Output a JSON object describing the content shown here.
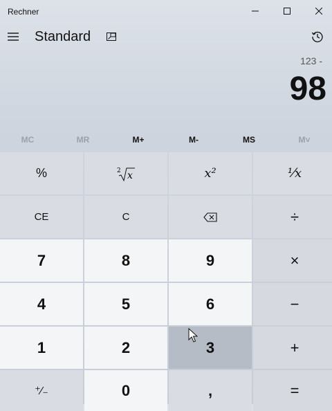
{
  "window": {
    "title": "Rechner"
  },
  "header": {
    "mode": "Standard"
  },
  "display": {
    "expression": "123 -",
    "value": "98"
  },
  "memory": [
    {
      "label": "MC",
      "enabled": false
    },
    {
      "label": "MR",
      "enabled": false
    },
    {
      "label": "M+",
      "enabled": true
    },
    {
      "label": "M-",
      "enabled": true
    },
    {
      "label": "MS",
      "enabled": true
    },
    {
      "label": "M˅",
      "enabled": false
    }
  ],
  "keys": {
    "percent": "%",
    "square": "x²",
    "reciprocal": "¹⁄x",
    "clear_entry": "CE",
    "clear": "C",
    "divide": "÷",
    "seven": "7",
    "eight": "8",
    "nine": "9",
    "multiply": "×",
    "four": "4",
    "five": "5",
    "six": "6",
    "minus": "−",
    "one": "1",
    "two": "2",
    "three": "3",
    "plus": "+",
    "negate": "⁺⁄₋",
    "zero": "0",
    "decimal": ",",
    "equals": "="
  },
  "state": {
    "pressed_key": "three"
  },
  "colors": {
    "pressed": "#b6bcc5",
    "digit_key": "#f4f5f7",
    "op_key": "#d9dde3"
  }
}
